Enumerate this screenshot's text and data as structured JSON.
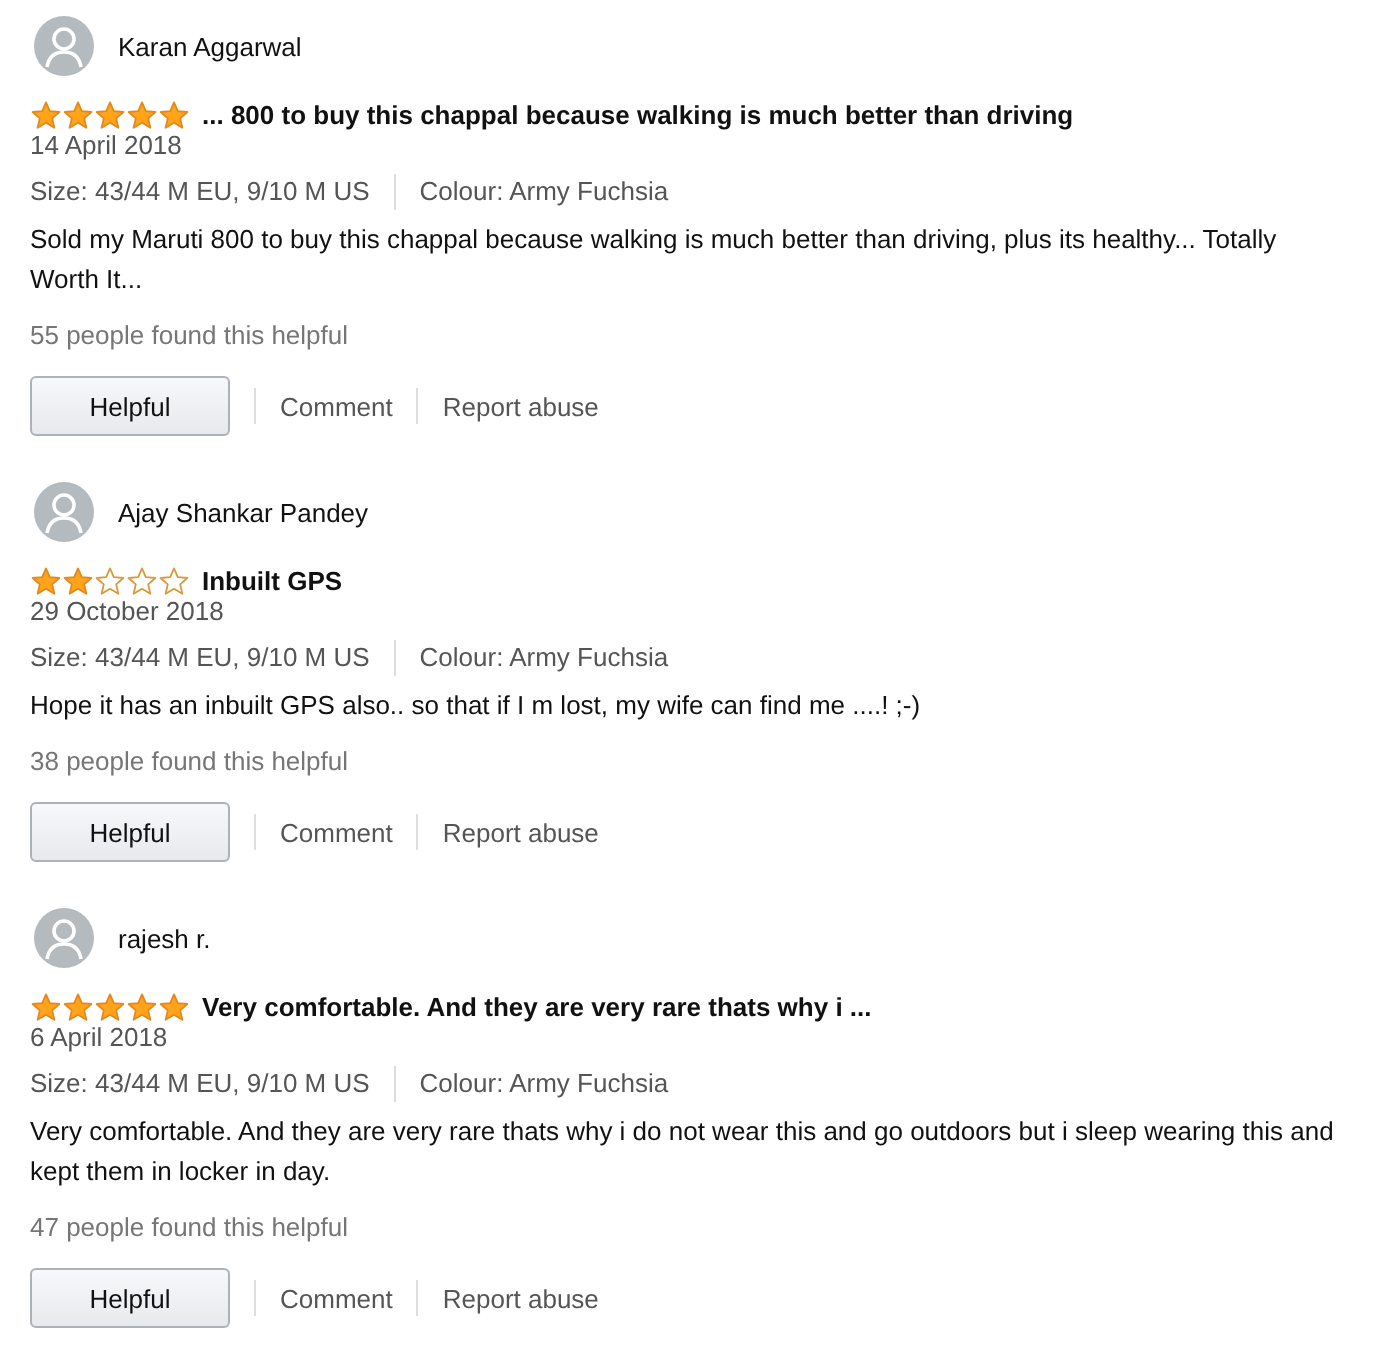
{
  "reviews": [
    {
      "author": "Karan Aggarwal",
      "stars": 5,
      "title": "... 800 to buy this chappal because walking is much better than driving",
      "date": "14 April 2018",
      "size": "Size: 43/44 M EU, 9/10 M US",
      "colour": "Colour: Army Fuchsia",
      "body": "Sold my Maruti 800 to buy this chappal because walking is much better than driving, plus its healthy... Totally Worth It...",
      "helpful_count": "55 people found this helpful",
      "helpful_button": "Helpful",
      "comment_link": "Comment",
      "report_link": "Report abuse"
    },
    {
      "author": "Ajay Shankar Pandey",
      "stars": 2,
      "title": "Inbuilt GPS",
      "date": "29 October 2018",
      "size": "Size: 43/44 M EU, 9/10 M US",
      "colour": "Colour: Army Fuchsia",
      "body": "Hope it has an inbuilt GPS also.. so that if I m lost, my wife can find me ....! ;-)",
      "helpful_count": "38 people found this helpful",
      "helpful_button": "Helpful",
      "comment_link": "Comment",
      "report_link": "Report abuse"
    },
    {
      "author": "rajesh r.",
      "stars": 5,
      "title": "Very comfortable. And they are very rare thats why i ...",
      "date": "6 April 2018",
      "size": "Size: 43/44 M EU, 9/10 M US",
      "colour": "Colour: Army Fuchsia",
      "body": "Very comfortable. And they are very rare thats why i do not wear this and go outdoors but i sleep wearing this and kept them in locker in day.",
      "helpful_count": "47 people found this helpful",
      "helpful_button": "Helpful",
      "comment_link": "Comment",
      "report_link": "Report abuse"
    }
  ]
}
